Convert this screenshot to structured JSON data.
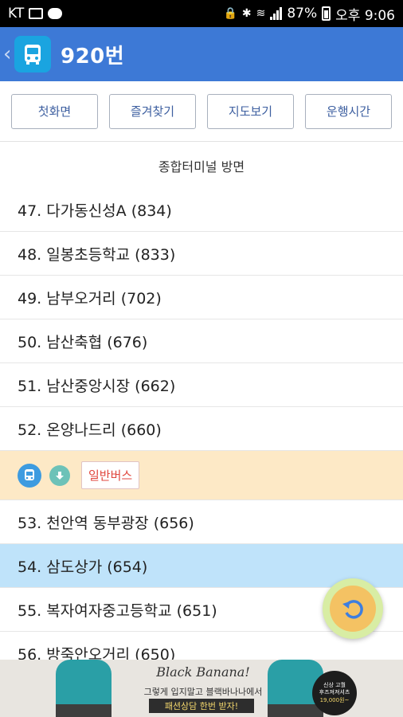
{
  "status_bar": {
    "carrier": "KT",
    "battery": "87%",
    "time": "오후 9:06"
  },
  "app_bar": {
    "title": "920번"
  },
  "buttons": {
    "first_screen": "첫화면",
    "favorites": "즐겨찾기",
    "map_view": "지도보기",
    "schedule": "운행시간"
  },
  "direction": "종합터미널 방면",
  "stops_before": [
    "47. 다가동신성A (834)",
    "48. 일봉초등학교 (833)",
    "49. 남부오거리 (702)",
    "50. 남산축협 (676)",
    "51. 남산중앙시장 (662)",
    "52. 온양나드리 (660)"
  ],
  "bus_row": {
    "bus_type": "일반버스"
  },
  "stops_after": [
    "53. 천안역 동부광장 (656)",
    "54. 삼도상가 (654)",
    "55. 복자여자중고등학교 (651)",
    "56. 방죽안오거리 (650)"
  ],
  "ad": {
    "brand": "Black Banana!",
    "copy": "그렇게 입지말고 블랙바나나에서",
    "highlight": "패션상담 한번 받자!",
    "badge_line1": "신상 고퀄",
    "badge_line2": "후즈져져셔츠",
    "badge_price": "19,000원~"
  },
  "colors": {
    "app_bar": "#3d79d6",
    "current_stop": "#bfe3fa",
    "bus_row": "#fde9c6",
    "bus_type_text": "#e0463c"
  }
}
